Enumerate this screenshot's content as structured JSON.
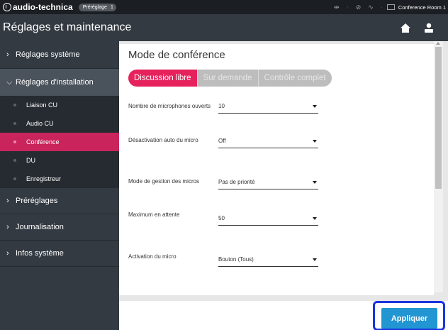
{
  "topbar": {
    "brand": "audio-technica",
    "preset_label": "Préréglage",
    "preset_number": "1",
    "room_name": "Conference Room 1"
  },
  "header": {
    "title": "Réglages et maintenance"
  },
  "sidebar": {
    "items": [
      {
        "label": "Réglages système",
        "state": "collapsed"
      },
      {
        "label": "Réglages d'installation",
        "state": "expanded"
      },
      {
        "label": "Préréglages",
        "state": "collapsed"
      },
      {
        "label": "Journalisation",
        "state": "collapsed"
      },
      {
        "label": "Infos système",
        "state": "collapsed"
      }
    ],
    "subitems": [
      {
        "label": "Liaison CU",
        "active": false
      },
      {
        "label": "Audio CU",
        "active": false
      },
      {
        "label": "Conférence",
        "active": true
      },
      {
        "label": "DU",
        "active": false
      },
      {
        "label": "Enregistreur",
        "active": false
      }
    ]
  },
  "main": {
    "section_title": "Mode de conférence",
    "tabs": [
      {
        "label": "Discussion libre",
        "active": true
      },
      {
        "label": "Sur demande",
        "active": false
      },
      {
        "label": "Contrôle complet",
        "active": false
      }
    ],
    "fields": [
      {
        "label": "Nombre de microphones ouverts",
        "value": "10"
      },
      {
        "label": "Désactivation auto du micro",
        "value": "Off"
      },
      {
        "label": "Mode de gestion des micros",
        "value": "Pas de priorité"
      },
      {
        "label": "Maximum en attente",
        "value": "50"
      },
      {
        "label": "Activation du micro",
        "value": "Bouton (Tous)"
      }
    ],
    "apply_label": "Appliquer"
  },
  "colors": {
    "accent_pink": "#e6225c",
    "active_nav": "#c9245b",
    "apply_blue": "#2196d3",
    "highlight_frame": "#1b34e0"
  }
}
